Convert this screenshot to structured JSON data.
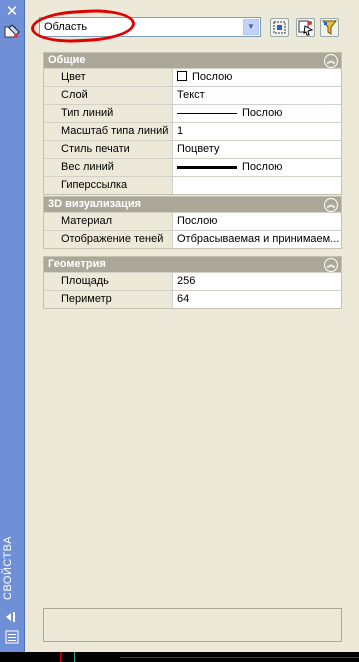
{
  "selector": {
    "value": "Область"
  },
  "sidebar": {
    "title": "СВОЙСТВА"
  },
  "sections": {
    "general": {
      "title": "Общие",
      "rows": [
        {
          "label": "Цвет",
          "value": "Послою"
        },
        {
          "label": "Слой",
          "value": "Текст"
        },
        {
          "label": "Тип линий",
          "value": "Послою"
        },
        {
          "label": "Масштаб типа линий",
          "value": "1"
        },
        {
          "label": "Стиль печати",
          "value": "Поцвету"
        },
        {
          "label": "Вес линий",
          "value": "Послою"
        },
        {
          "label": "Гиперссылка",
          "value": ""
        }
      ]
    },
    "viz3d": {
      "title": "3D визуализация",
      "rows": [
        {
          "label": "Материал",
          "value": "Послою"
        },
        {
          "label": "Отображение теней",
          "value": "Отбрасываемая и принимаем..."
        }
      ]
    },
    "geometry": {
      "title": "Геометрия",
      "rows": [
        {
          "label": "Площадь",
          "value": "256"
        },
        {
          "label": "Периметр",
          "value": "64"
        }
      ]
    }
  },
  "colors": {
    "sidebar": "#6f8fd6",
    "section_header": "#aca899",
    "annotation": "#e00000"
  },
  "icons": [
    "close-icon",
    "properties-tools-icon",
    "quick-select-icon",
    "select-objects-icon",
    "pickadd-filter-icon",
    "collapse-icon",
    "autohide-icon",
    "menu-icon"
  ]
}
